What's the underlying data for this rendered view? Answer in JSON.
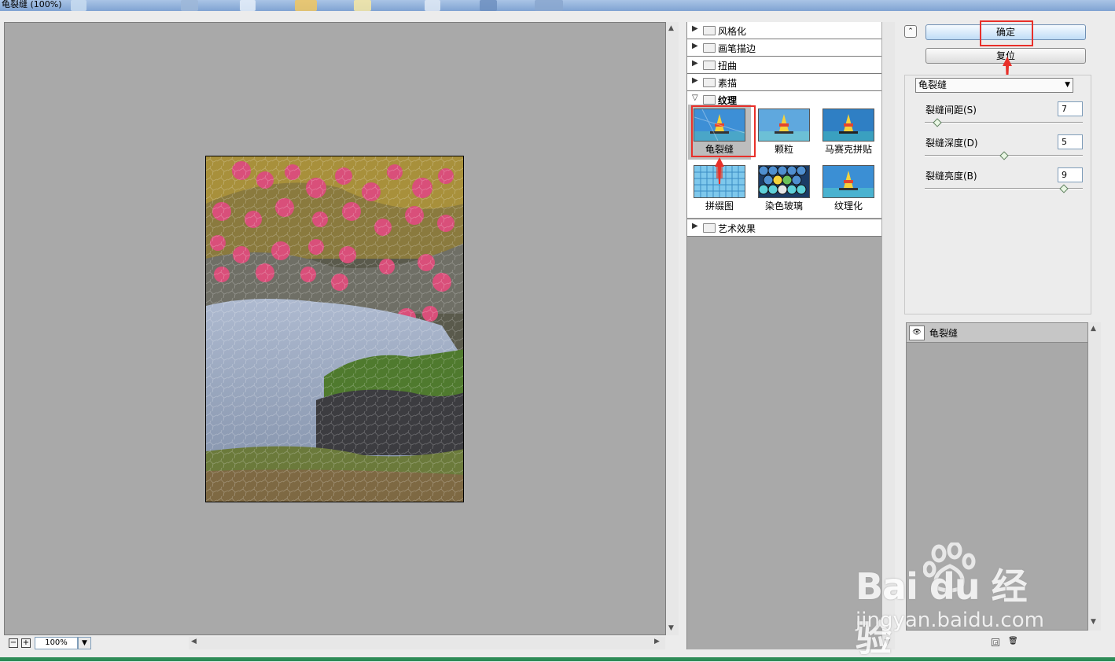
{
  "window": {
    "title": "龟裂缝 (100%)"
  },
  "zoom": {
    "minus": "−",
    "plus": "+",
    "value": "100%",
    "dropdown_glyph": "▼"
  },
  "filter_tree": {
    "folders": [
      {
        "label": "风格化",
        "expanded": false
      },
      {
        "label": "画笔描边",
        "expanded": false
      },
      {
        "label": "扭曲",
        "expanded": false
      },
      {
        "label": "素描",
        "expanded": false
      },
      {
        "label": "纹理",
        "expanded": true
      },
      {
        "label": "艺术效果",
        "expanded": false
      }
    ],
    "thumbnails": [
      {
        "label": "龟裂缝",
        "selected": true
      },
      {
        "label": "颗粒",
        "selected": false
      },
      {
        "label": "马赛克拼贴",
        "selected": false
      },
      {
        "label": "拼缀图",
        "selected": false
      },
      {
        "label": "染色玻璃",
        "selected": false
      },
      {
        "label": "纹理化",
        "selected": false
      }
    ]
  },
  "actions": {
    "ok_label": "确定",
    "reset_label": "复位",
    "collapse_glyph": "⌃"
  },
  "settings": {
    "filter_select": "龟裂缝",
    "params": [
      {
        "label": "裂缝间距(S)",
        "value": "7",
        "fraction": 0.05
      },
      {
        "label": "裂缝深度(D)",
        "value": "5",
        "fraction": 0.5
      },
      {
        "label": "裂缝亮度(B)",
        "value": "9",
        "fraction": 0.9
      }
    ]
  },
  "layers": {
    "items": [
      {
        "name": "龟裂缝",
        "visible": true
      }
    ]
  },
  "watermark": {
    "brand": "Bai du 经验",
    "url": "jingyan.baidu.com"
  },
  "colors": {
    "highlight_red": "#e8302a",
    "panel_gray": "#a9a9a9",
    "button_blue": "#bfdcf6"
  }
}
